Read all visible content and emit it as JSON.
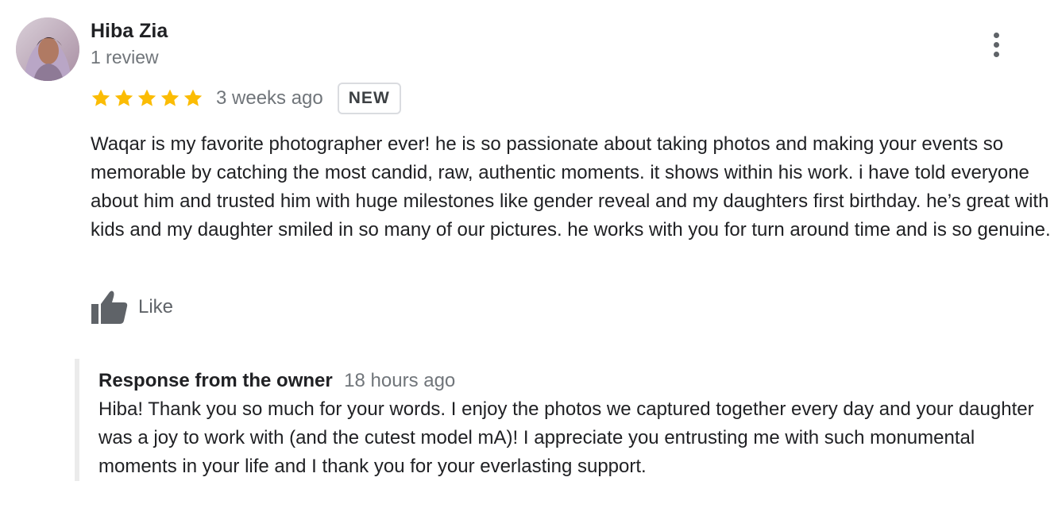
{
  "review": {
    "author": {
      "name": "Hiba Zia",
      "review_count": "1 review",
      "avatar_icon": "user-photo-avatar"
    },
    "rating": {
      "stars": 5,
      "max": 5,
      "star_color": "#fbbc04"
    },
    "time": "3 weeks ago",
    "badge": "NEW",
    "text": "Waqar is my favorite photographer ever! he is so passionate about taking photos and making your events so memorable by catching the most candid, raw, authentic moments. it shows within his work. i have told everyone about him and trusted him with huge milestones like gender reveal and my daughters first birthday. he’s great with kids and my daughter smiled in so many of our pictures. he works with you for turn around time and is so genuine.",
    "like_label": "Like",
    "menu_icon": "more-vert-icon"
  },
  "owner_response": {
    "title": "Response from the owner",
    "time": "18 hours ago",
    "text": "Hiba! Thank you so much for your words. I enjoy the photos we captured together every day and your daughter was a joy to work with (and the cutest model mA)! I appreciate you entrusting me with such monumental moments in your life and I thank you for your everlasting support."
  },
  "colors": {
    "primary_text": "#202124",
    "secondary_text": "#70757a",
    "icon_gray": "#5f6368",
    "badge_border": "#dadce0",
    "response_bar": "#ebebeb"
  }
}
